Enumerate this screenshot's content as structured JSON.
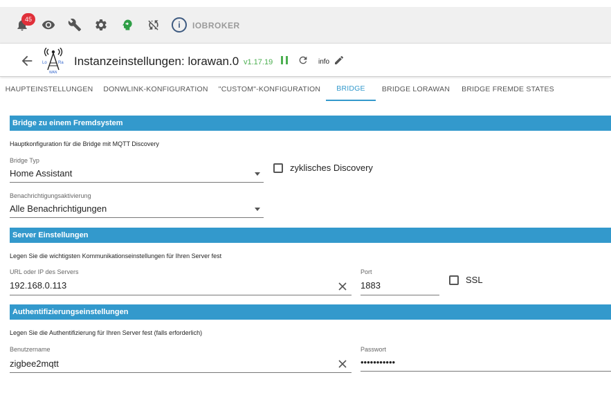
{
  "toolbar": {
    "notification_count": "45",
    "brand": "IOBROKER",
    "brand_logo_letter": "i"
  },
  "header": {
    "title": "Instanzeinstellungen: lorawan.0",
    "version": "v1.17.19",
    "info_label": "info",
    "adapter_logo_text": "LoRaWAN"
  },
  "tabs": [
    {
      "label": "HAUPTEINSTELLUNGEN"
    },
    {
      "label": "DONWLINK-KONFIGURATION"
    },
    {
      "label": "\"CUSTOM\"-KONFIGURATION"
    },
    {
      "label": "BRIDGE"
    },
    {
      "label": "BRIDGE LORAWAN"
    },
    {
      "label": "BRIDGE FREMDE STATES"
    }
  ],
  "sections": {
    "bridge": {
      "title": "Bridge zu einem Fremdsystem",
      "description": "Hauptkonfiguration für die Bridge mit MQTT Discovery",
      "bridge_type": {
        "label": "Bridge Typ",
        "value": "Home Assistant"
      },
      "cyclic_discovery": {
        "label": "zyklisches Discovery",
        "checked": false
      },
      "notification": {
        "label": "Benachrichtigungsaktivierung",
        "value": "Alle Benachrichtigungen"
      }
    },
    "server": {
      "title": "Server Einstellungen",
      "description": "Legen Sie die wichtigsten Kommunikationseinstellungen für Ihren Server fest",
      "url": {
        "label": "URL oder IP des Servers",
        "value": "192.168.0.113"
      },
      "port": {
        "label": "Port",
        "value": "1883"
      },
      "ssl": {
        "label": "SSL",
        "checked": false
      }
    },
    "auth": {
      "title": "Authentifizierungseinstellungen",
      "description": "Legen Sie die Authentifizierung für Ihren Server fest (falls erforderlich)",
      "username": {
        "label": "Benutzername",
        "value": "zigbee2mqtt"
      },
      "password": {
        "label": "Passwort",
        "value": "•••••••••••"
      }
    }
  },
  "colors": {
    "accent": "#3399cc",
    "version": "#4caf50",
    "badge": "#e0303a"
  }
}
